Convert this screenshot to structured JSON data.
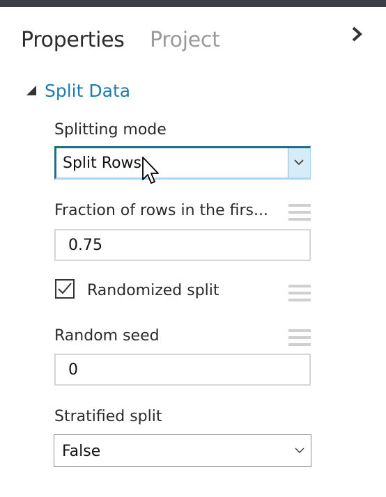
{
  "tabs": [
    {
      "label": "Properties",
      "active": true
    },
    {
      "label": "Project",
      "active": false
    }
  ],
  "panel": {
    "collapse_icon": "chevron-right-icon"
  },
  "section": {
    "title": "Split Data",
    "expanded": true,
    "toggle_icon": "triangle-expanded-icon"
  },
  "fields": {
    "splitting_mode": {
      "label": "Splitting mode",
      "value": "Split Rows"
    },
    "fraction": {
      "label": "Fraction of rows in the firs...",
      "value": "0.75"
    },
    "randomized": {
      "label": "Randomized split",
      "checked": true
    },
    "seed": {
      "label": "Random seed",
      "value": "0"
    },
    "stratified": {
      "label": "Stratified split",
      "value": "False"
    }
  },
  "colors": {
    "accent": "#1f7bb0",
    "topbar": "#3b3f45",
    "dropdown_border": "#1d6e89",
    "dropdown_highlight": "#d6ecf8"
  },
  "icons": {
    "handle": "hamburger-handle-icon",
    "dropdown_arrow": "chevron-down-icon",
    "pointer": "mouse-pointer-icon"
  }
}
